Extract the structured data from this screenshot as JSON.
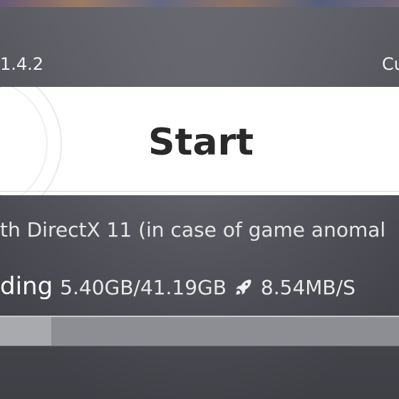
{
  "launcher": {
    "version": "1.4.2",
    "right_label": "Cu"
  },
  "start_button": {
    "label": "Start"
  },
  "notice": {
    "text": "th DirectX 11 (in case of game anomal"
  },
  "download": {
    "status": "ding",
    "size": "5.40GB/41.19GB",
    "speed": "8.54MB/S",
    "progress": 0.131,
    "speed_icon": "rocket-icon"
  },
  "colors": {
    "panel": "#ffffff",
    "text_dark": "#2a2a2a",
    "text_light": "#f2f2f2",
    "progress_track": "#8d8e93"
  }
}
